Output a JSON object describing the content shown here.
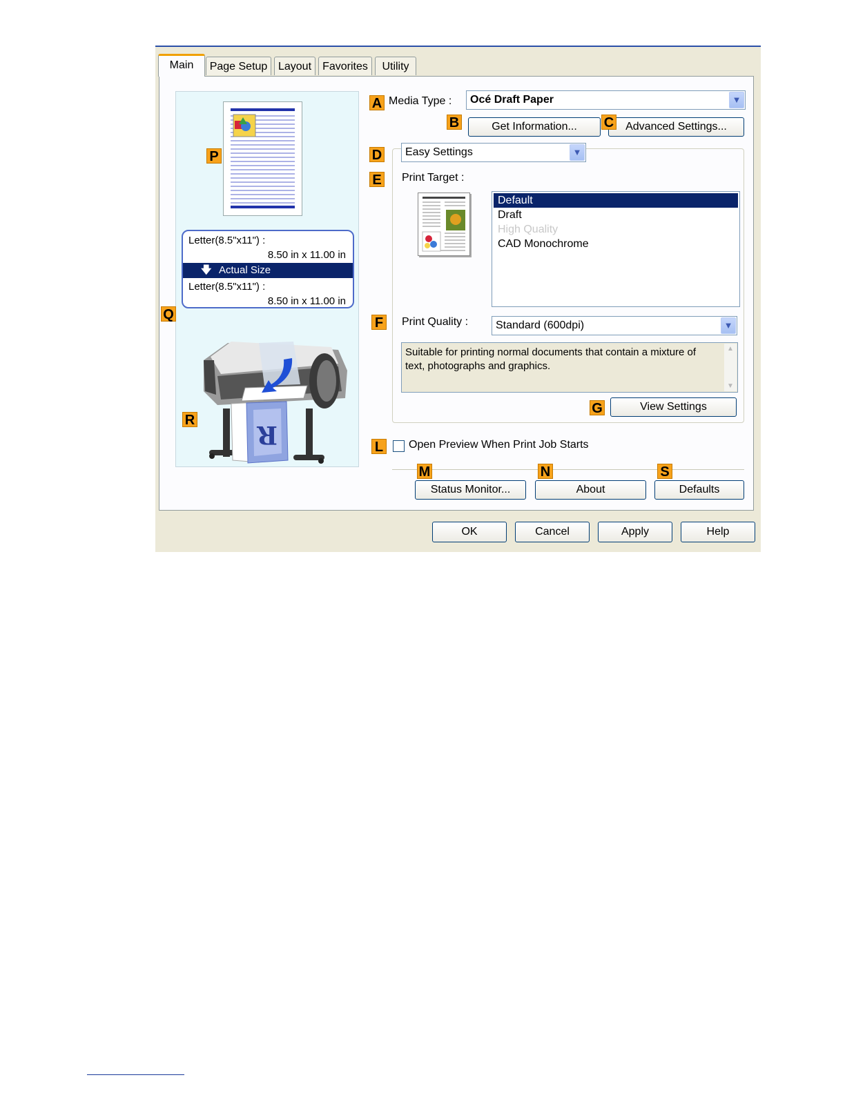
{
  "tabs": [
    {
      "label": "Main"
    },
    {
      "label": "Page Setup"
    },
    {
      "label": "Layout"
    },
    {
      "label": "Favorites"
    },
    {
      "label": "Utility"
    }
  ],
  "markers": {
    "A": "A",
    "B": "B",
    "C": "C",
    "D": "D",
    "E": "E",
    "F": "F",
    "G": "G",
    "L": "L",
    "M": "M",
    "N": "N",
    "S": "S",
    "P": "P",
    "Q": "Q",
    "R": "R"
  },
  "media_type": {
    "label": "Media Type :",
    "value": "Océ Draft Paper"
  },
  "buttons": {
    "get_information": "Get Information...",
    "advanced_settings": "Advanced Settings...",
    "view_settings": "View Settings",
    "status_monitor": "Status Monitor...",
    "about": "About",
    "defaults": "Defaults",
    "ok": "OK",
    "cancel": "Cancel",
    "apply": "Apply",
    "help": "Help"
  },
  "settings_mode": {
    "value": "Easy Settings"
  },
  "print_target": {
    "label": "Print Target :",
    "items": [
      {
        "label": "Default",
        "state": "selected"
      },
      {
        "label": "Draft",
        "state": "normal"
      },
      {
        "label": "High Quality",
        "state": "disabled"
      },
      {
        "label": "CAD Monochrome",
        "state": "normal"
      }
    ]
  },
  "print_quality": {
    "label": "Print Quality :",
    "value": "Standard (600dpi)",
    "description": "Suitable for printing normal documents that contain a mixture of text, photographs and graphics."
  },
  "open_preview": {
    "label": "Open Preview When Print Job Starts",
    "checked": false
  },
  "paper_settings": {
    "original_name": "Letter(8.5\"x11\") :",
    "original_size": "8.50 in x 11.00 in",
    "scaling": "Actual Size",
    "output_name": "Letter(8.5\"x11\") :",
    "output_size": "8.50 in x 11.00 in"
  },
  "printer_sheet_letter": "R",
  "colors": {
    "marker": "#f7a21b",
    "selection": "#0a246a",
    "preview_bg": "#e8f8fb",
    "dialog_bg": "#ece9d8"
  }
}
